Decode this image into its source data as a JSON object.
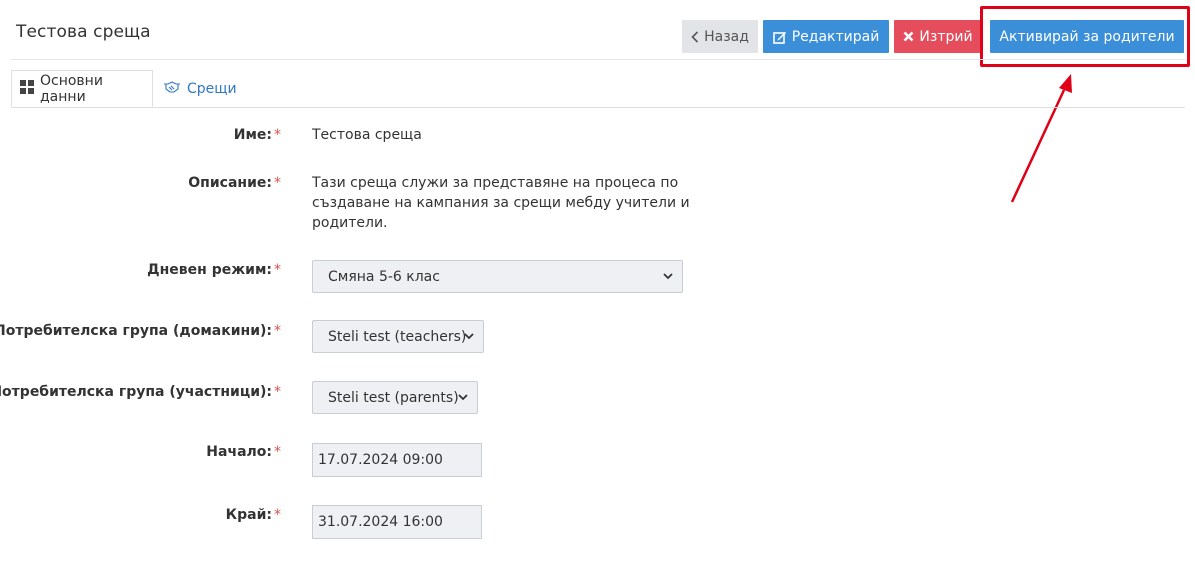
{
  "page": {
    "title": "Тестова среща"
  },
  "toolbar": {
    "back_label": "Назад",
    "edit_label": "Редактирай",
    "delete_label": "Изтрий",
    "activate_label": "Активирай за родители"
  },
  "tabs": [
    {
      "label": "Основни данни",
      "icon": "grid-icon",
      "active": true
    },
    {
      "label": "Срещи",
      "icon": "handshake-icon",
      "active": false
    }
  ],
  "form": {
    "required_mark": "*",
    "name": {
      "label": "Име:",
      "value": "Тестова среща"
    },
    "description": {
      "label": "Описание:",
      "value": "Тази среща служи за представяне на процеса по създаване на кампания за срещи мебду учители и родители."
    },
    "day_mode": {
      "label": "Дневен режим:",
      "value": "Смяна 5-6 клас"
    },
    "host_group": {
      "label": "Потребителска група (домакини):",
      "value": "Steli test (teachers)"
    },
    "participant_group": {
      "label": "Потребителска група (участници):",
      "value": "Steli test (parents)"
    },
    "start": {
      "label": "Начало:",
      "value": "17.07.2024 09:00"
    },
    "end": {
      "label": "Край:",
      "value": "31.07.2024 16:00"
    }
  },
  "colors": {
    "primary": "#3a8fd8",
    "danger": "#e54d5c",
    "highlight": "#e00018",
    "link": "#2f78c4"
  }
}
